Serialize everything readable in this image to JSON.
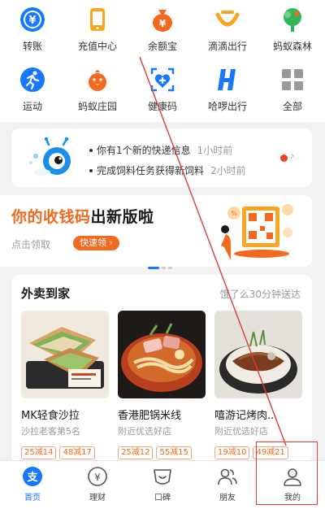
{
  "app_grid": {
    "row1": [
      {
        "label": "转账",
        "icon": "transfer-icon",
        "color": "#1677ff"
      },
      {
        "label": "充值中心",
        "icon": "phone-recharge-icon",
        "color": "#f5a623"
      },
      {
        "label": "余额宝",
        "icon": "money-bag-icon",
        "color": "#f26a1f"
      },
      {
        "label": "滴滴出行",
        "icon": "didi-icon",
        "color": "#f5a623"
      },
      {
        "label": "蚂蚁森林",
        "icon": "tree-icon",
        "color": "#2fb55a"
      }
    ],
    "row2": [
      {
        "label": "运动",
        "icon": "running-icon",
        "color": "#1677ff"
      },
      {
        "label": "蚂蚁庄园",
        "icon": "chick-icon",
        "color": "#f26a1f"
      },
      {
        "label": "健康码",
        "icon": "health-code-icon",
        "color": "#1677ff"
      },
      {
        "label": "哈啰出行",
        "icon": "hello-bike-icon",
        "color": "#1677ff"
      },
      {
        "label": "全部",
        "icon": "all-apps-icon",
        "color": "#999999"
      }
    ]
  },
  "notice": {
    "items": [
      {
        "text": "你有1个新的快递信息",
        "time": "1小时前"
      },
      {
        "text": "完成饲料任务获得新饲料",
        "time": "2小时前"
      }
    ]
  },
  "banner": {
    "title_orange": "你的收钱码",
    "title_dark": "出新版啦",
    "sub": "点击领取",
    "button": "快速领 ›"
  },
  "delivery": {
    "title": "外卖到家",
    "subtitle": "饿了么30分钟送达",
    "items": [
      {
        "name": "MK轻食沙拉",
        "desc": "沙拉老客第5名",
        "tags": [
          "25减14",
          "48减17"
        ]
      },
      {
        "name": "香港肥锅米线",
        "desc": "附近优选好店",
        "tags": [
          "25减12",
          "55减15"
        ]
      },
      {
        "name": "嘻游记烤肉...",
        "desc": "附近优选好店",
        "tags": [
          "19减10",
          "49减21"
        ]
      }
    ]
  },
  "tabbar": {
    "items": [
      {
        "label": "首页",
        "icon": "home-icon",
        "active": true
      },
      {
        "label": "理财",
        "icon": "finance-icon",
        "active": false
      },
      {
        "label": "口碑",
        "icon": "koubei-icon",
        "active": false
      },
      {
        "label": "朋友",
        "icon": "friends-icon",
        "active": false
      },
      {
        "label": "我的",
        "icon": "profile-icon",
        "active": false
      }
    ]
  },
  "colors": {
    "accent_blue": "#1677ff",
    "accent_orange": "#f26a1f",
    "annotation_red": "#e03a3a"
  }
}
